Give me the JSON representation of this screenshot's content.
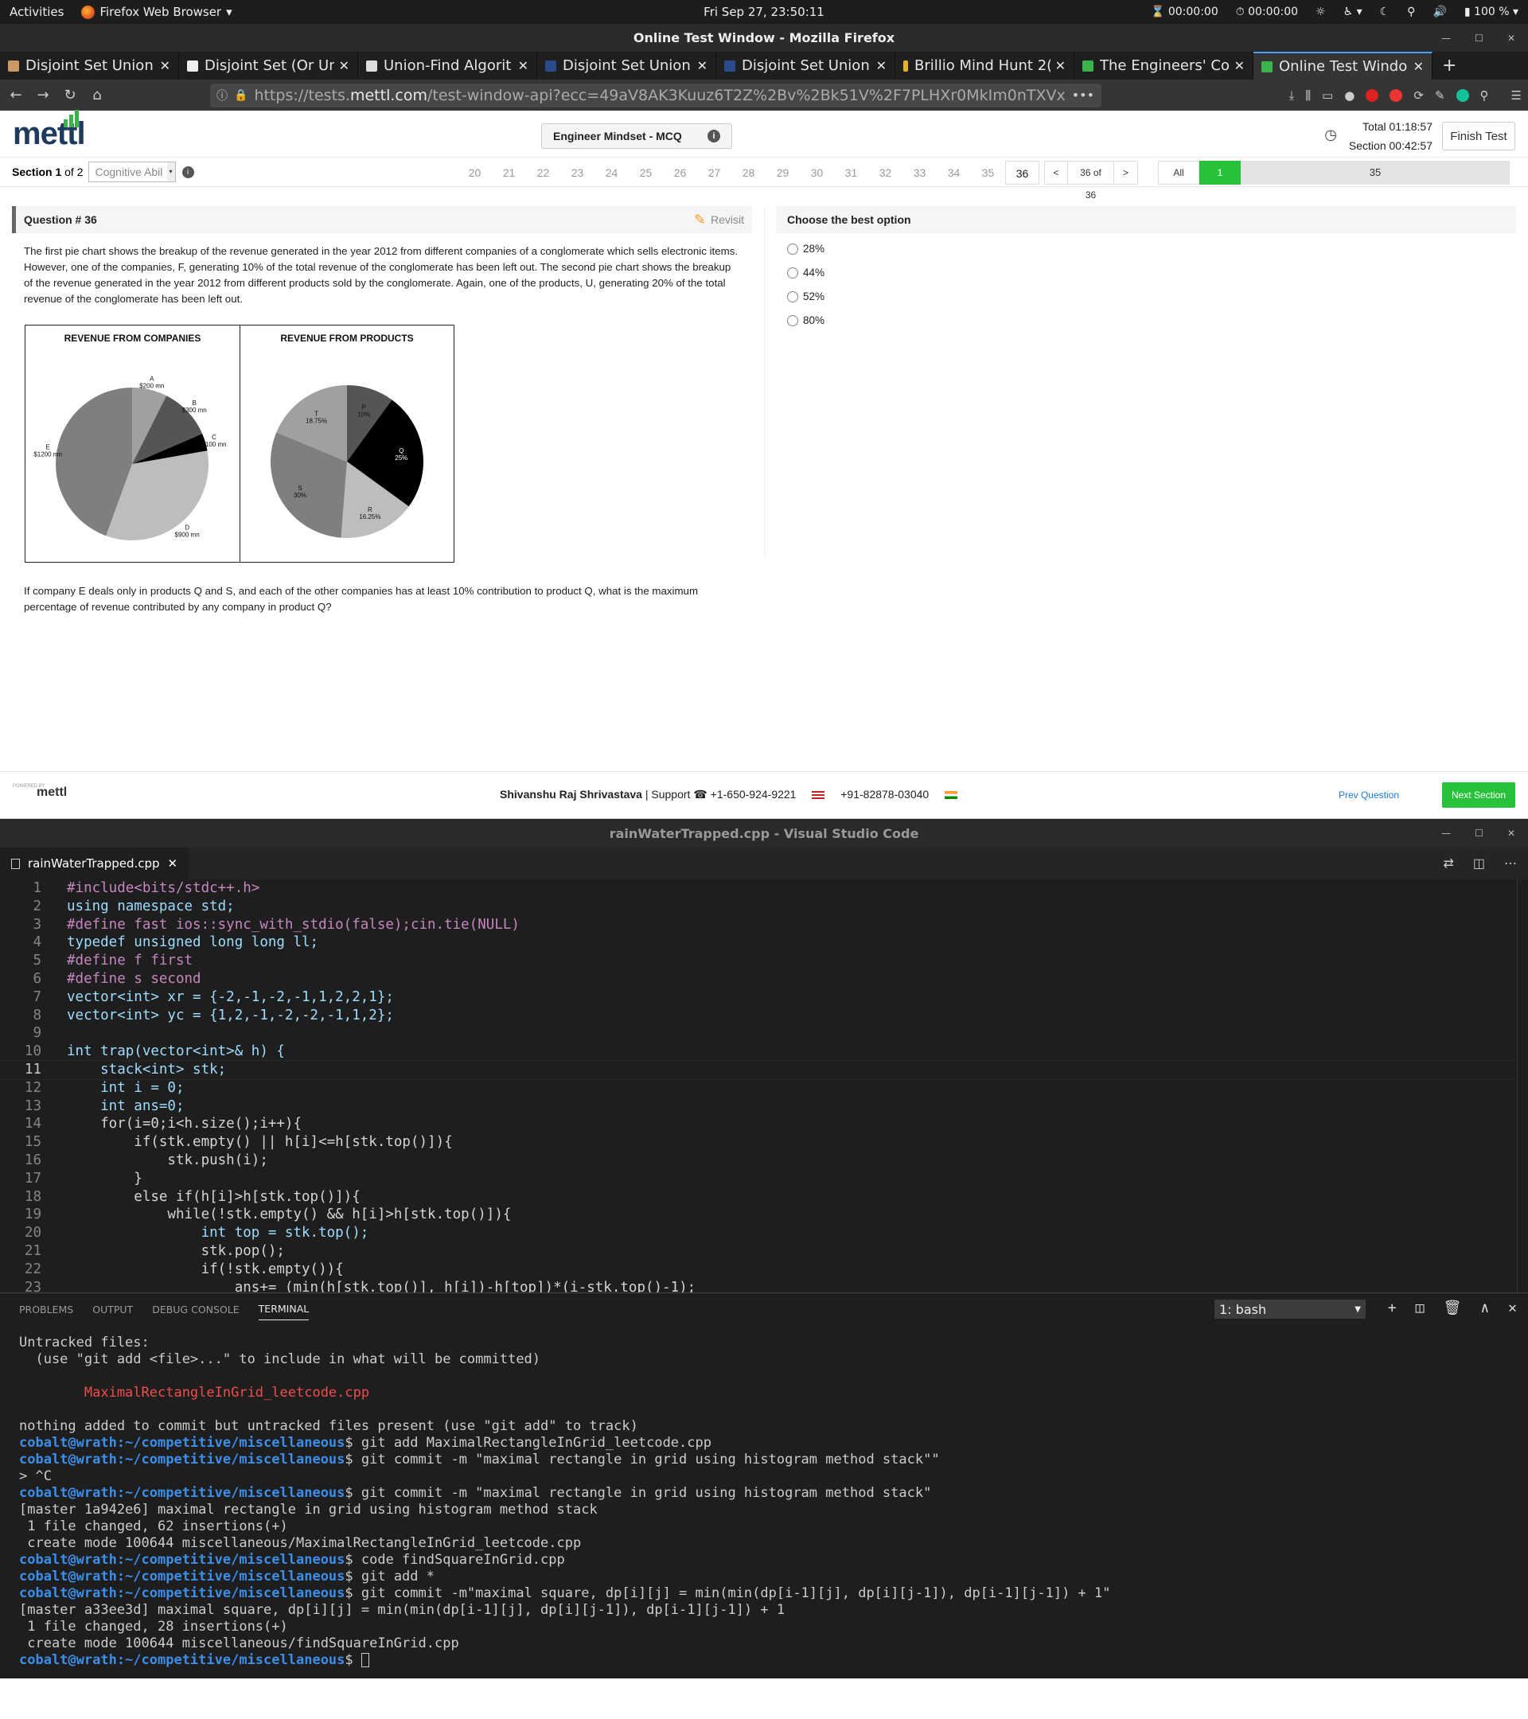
{
  "topbar": {
    "activities": "Activities",
    "app": "Firefox Web Browser",
    "app_arrow": "▾",
    "clock": "Fri Sep 27, 23:50:11",
    "timer1": "00:00:00",
    "timer2": "00:00:00",
    "battery": "100 %"
  },
  "firefox": {
    "title": "Online Test Window - Mozilla Firefox",
    "tabs": [
      {
        "label": "Disjoint Set Union"
      },
      {
        "label": "Disjoint Set (Or Uni"
      },
      {
        "label": "Union-Find Algorit"
      },
      {
        "label": "Disjoint Set Union"
      },
      {
        "label": "Disjoint Set Union"
      },
      {
        "label": "Brillio Mind Hunt 2("
      },
      {
        "label": "The Engineers' Coc"
      },
      {
        "label": "Online Test Windo"
      }
    ],
    "url_prefix": "https://tests.",
    "url_domain": "mettl.com",
    "url_rest": "/test-window-api?ecc=49aV8AK3Kuuz6T2Z%2Bv%2Bk51V%2F7PLHXr0MkIm0nTXVx",
    "url_more": "•••"
  },
  "mettl": {
    "logo": "mettl",
    "test_name": "Engineer Mindset - MCQ",
    "total": "Total 01:18:57",
    "section_time": "Section 00:42:57",
    "finish": "Finish Test",
    "section_label": "Section 1",
    "section_of": "of 2",
    "section_select": "Cognitive Abil",
    "qnums": [
      "20",
      "21",
      "22",
      "23",
      "24",
      "25",
      "26",
      "27",
      "28",
      "29",
      "30",
      "31",
      "32",
      "33",
      "34",
      "35",
      "36"
    ],
    "prev_arrow": "<",
    "page_of": "36 of 36",
    "next_arrow": ">",
    "filter_all": "All",
    "filter_answered": "1",
    "filter_unanswered": "35",
    "question_title": "Question # 36",
    "revisit": "Revisit",
    "question_text": "The first pie chart shows the breakup of the revenue generated in the year 2012 from different companies of a conglomerate which sells electronic items. However, one of the companies, F, generating 10% of the total revenue of the conglomerate has been left out. The second pie chart shows the breakup of the revenue generated in the year 2012 from different products sold by the conglomerate. Again, one of the products, U, generating 20% of the total revenue of the conglomerate has been left out.",
    "question_ask": "If company E deals only in products Q and S, and each of the other companies has at least 10% contribution to product Q, what is the maximum percentage of revenue contributed by any company in product Q?",
    "options_title": "Choose the best option",
    "options": [
      "28%",
      "44%",
      "52%",
      "80%"
    ],
    "footer_powered": "POWERED BY",
    "footer_logo": "mettl",
    "footer_name": "Shivanshu Raj Shrivastava",
    "footer_support": "| Support",
    "phone_us": "+1-650-924-9221",
    "phone_in": "+91-82878-03040",
    "prev_question": "Prev Question",
    "next_section": "Next Section"
  },
  "chart_data": [
    {
      "type": "pie",
      "title": "REVENUE FROM COMPANIES",
      "categories": [
        "A",
        "B",
        "C",
        "D",
        "E"
      ],
      "values": [
        200,
        300,
        100,
        900,
        1200
      ],
      "labels": [
        "$200 mn",
        "$300 mn",
        "$100 mn",
        "$900 mn",
        "$1200 mn"
      ],
      "colors": [
        "#a0a0a0",
        "#555555",
        "#000000",
        "#bdbdbd",
        "#7f7f7f"
      ]
    },
    {
      "type": "pie",
      "title": "REVENUE FROM PRODUCTS",
      "categories": [
        "P",
        "Q",
        "R",
        "S",
        "T"
      ],
      "values": [
        10,
        25,
        16.25,
        30,
        18.75
      ],
      "labels": [
        "10%",
        "25%",
        "16.25%",
        "30%",
        "18.75%"
      ],
      "colors": [
        "#555555",
        "#000000",
        "#bdbdbd",
        "#7f7f7f",
        "#a0a0a0"
      ]
    }
  ],
  "vscode": {
    "title": "rainWaterTrapped.cpp - Visual Studio Code",
    "tab": "rainWaterTrapped.cpp",
    "tab_close": "✕",
    "code": [
      "#include<bits/stdc++.h>",
      "using namespace std;",
      "#define fast ios::sync_with_stdio(false);cin.tie(NULL)",
      "typedef unsigned long long ll;",
      "#define f first",
      "#define s second",
      "vector<int> xr = {-2,-1,-2,-1,1,2,2,1};",
      "vector<int> yc = {1,2,-1,-2,-2,-1,1,2};",
      "",
      "int trap(vector<int>& h) {",
      "    stack<int> stk;",
      "    int i = 0;",
      "    int ans=0;",
      "    for(i=0;i<h.size();i++){",
      "        if(stk.empty() || h[i]<=h[stk.top()]){",
      "            stk.push(i);",
      "        }",
      "        else if(h[i]>h[stk.top()]){",
      "            while(!stk.empty() && h[i]>h[stk.top()]){",
      "                int top = stk.top();",
      "                stk.pop();",
      "                if(!stk.empty()){",
      "                    ans+= (min(h[stk.top()], h[i])-h[top])*(i-stk.top()-1);"
    ],
    "current_line": 11,
    "panel_tabs": [
      "PROBLEMS",
      "OUTPUT",
      "DEBUG CONSOLE",
      "TERMINAL"
    ],
    "terminal_select": "1: bash",
    "terminal": [
      {
        "t": "Untracked files:"
      },
      {
        "t": "  (use \"git add <file>...\" to include in what will be committed)"
      },
      {
        "t": ""
      },
      {
        "t": "        MaximalRectangleInGrid_leetcode.cpp",
        "c": "red"
      },
      {
        "t": ""
      },
      {
        "t": "nothing added to commit but untracked files present (use \"git add\" to track)"
      },
      {
        "p": "cobalt@wrath:~/competitive/miscellaneous",
        "t": "$ git add MaximalRectangleInGrid_leetcode.cpp"
      },
      {
        "p": "cobalt@wrath:~/competitive/miscellaneous",
        "t": "$ git commit -m \"maximal rectangle in grid using histogram method stack\"\""
      },
      {
        "t": "> ^C"
      },
      {
        "p": "cobalt@wrath:~/competitive/miscellaneous",
        "t": "$ git commit -m \"maximal rectangle in grid using histogram method stack\""
      },
      {
        "t": "[master 1a942e6] maximal rectangle in grid using histogram method stack"
      },
      {
        "t": " 1 file changed, 62 insertions(+)"
      },
      {
        "t": " create mode 100644 miscellaneous/MaximalRectangleInGrid_leetcode.cpp"
      },
      {
        "p": "cobalt@wrath:~/competitive/miscellaneous",
        "t": "$ code findSquareInGrid.cpp"
      },
      {
        "p": "cobalt@wrath:~/competitive/miscellaneous",
        "t": "$ git add *"
      },
      {
        "p": "cobalt@wrath:~/competitive/miscellaneous",
        "t": "$ git commit -m\"maximal square, dp[i][j] = min(min(dp[i-1][j], dp[i][j-1]), dp[i-1][j-1]) + 1\""
      },
      {
        "t": "[master a33ee3d] maximal square, dp[i][j] = min(min(dp[i-1][j], dp[i][j-1]), dp[i-1][j-1]) + 1"
      },
      {
        "t": " 1 file changed, 28 insertions(+)"
      },
      {
        "t": " create mode 100644 miscellaneous/findSquareInGrid.cpp"
      },
      {
        "p": "cobalt@wrath:~/competitive/miscellaneous",
        "t": "$ ",
        "cursor": true
      }
    ]
  }
}
